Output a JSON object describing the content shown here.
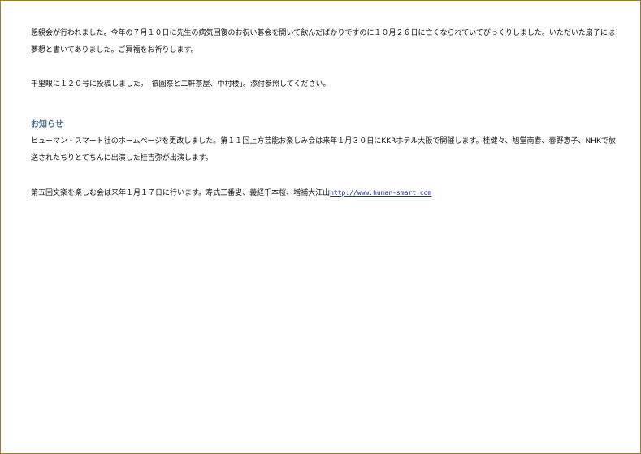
{
  "content": {
    "para1": "懇親会が行われました。今年の７月１０日に先生の病気回復のお祝い碁会を開いて飲んだばかりですのに１０月２６日に亡くなられていてびっくりしました。いただいた扇子には夢想と書いてありました。ご冥福をお祈りします。",
    "para2": "千里眼に１２０号に投稿しました。「祇園祭と二軒茶屋、中村楼」。添付参照してください。",
    "notice_heading": "お知らせ",
    "para3": "ヒューマン・スマート社のホームページを更改しました。第１１回上方芸能お楽しみ会は来年１月３０日にKKRホテル大阪で開催します。桂健々、旭堂南春、春野恵子、NHKで放送されたちりとてちんに出演した桂吉弥が出演します。",
    "para4": "第五回文楽を楽しむ会は来年１月１７日に行います。寿式三番叟、義経千本桜、増補大江山",
    "link_text": "http://www.human-smart.com"
  }
}
